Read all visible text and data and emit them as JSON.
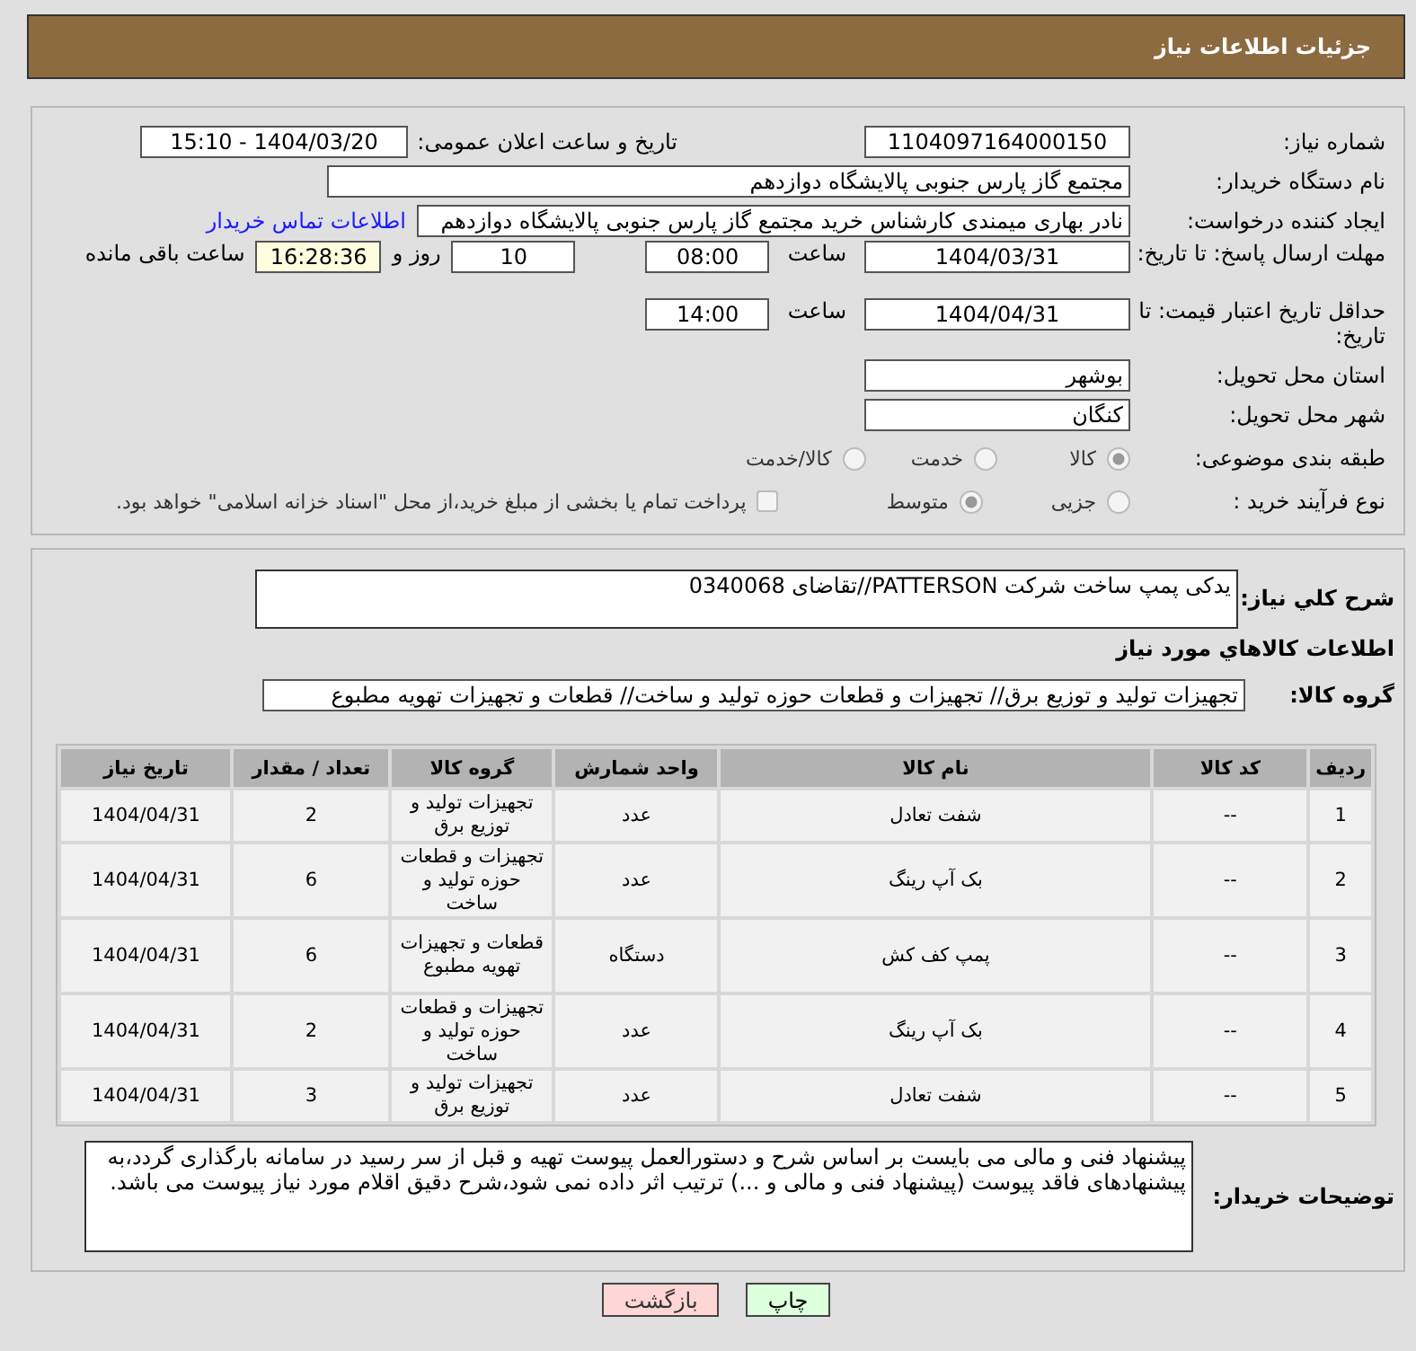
{
  "header": {
    "title": "جزئیات اطلاعات نیاز"
  },
  "details": {
    "need_number": {
      "label": "شماره نیاز:",
      "value": "1104097164000150"
    },
    "announce": {
      "label": "تاریخ و ساعت اعلان عمومی:",
      "value": "1404/03/20 - 15:10"
    },
    "buyer": {
      "label": "نام دستگاه خریدار:",
      "value": "مجتمع گاز پارس جنوبی  پالایشگاه دوازدهم"
    },
    "creator": {
      "label": "ایجاد کننده درخواست:",
      "value": "نادر بهاری میمندی کارشناس خرید مجتمع گاز پارس جنوبی  پالایشگاه دوازدهم",
      "link": "اطلاعات تماس خریدار"
    },
    "deadline": {
      "label": "مهلت ارسال پاسخ: تا تاریخ:",
      "date": "1404/03/31",
      "time_label": "ساعت",
      "time": "08:00",
      "days": "10",
      "days_label": "روز و",
      "remaining": "16:28:36",
      "remaining_label": "ساعت باقی مانده"
    },
    "validity": {
      "label": "حداقل تاریخ اعتبار قیمت: تا تاریخ:",
      "date": "1404/04/31",
      "time_label": "ساعت",
      "time": "14:00"
    },
    "province": {
      "label": "استان محل تحویل:",
      "value": "بوشهر"
    },
    "city": {
      "label": "شهر محل تحویل:",
      "value": "کنگان"
    },
    "category": {
      "label": "طبقه بندی موضوعی:",
      "options": [
        {
          "label": "کالا",
          "selected": true
        },
        {
          "label": "خدمت",
          "selected": false
        },
        {
          "label": "کالا/خدمت",
          "selected": false
        }
      ]
    },
    "process": {
      "label": "نوع فرآیند خرید :",
      "options": [
        {
          "label": "جزیی",
          "selected": false
        },
        {
          "label": "متوسط",
          "selected": true
        }
      ],
      "treasury": {
        "label": "پرداخت تمام یا بخشی از مبلغ خرید،از محل \"اسناد خزانه اسلامی\" خواهد بود.",
        "checked": false
      }
    }
  },
  "need": {
    "description_label": "شرح کلي نیاز:",
    "description": "یدکی پمپ ساخت شرکت PATTERSON//تقاضای 0340068",
    "goods_title": "اطلاعات کالاهاي مورد نیاز",
    "group_label": "گروه کالا:",
    "group": "تجهیزات تولید و توزیع برق// تجهیزات و قطعات حوزه تولید و ساخت//  قطعات و تجهیزات تهویه مطبوع"
  },
  "table": {
    "columns": [
      "ردیف",
      "کد کالا",
      "نام کالا",
      "واحد شمارش",
      "گروه کالا",
      "تعداد / مقدار",
      "تاریخ نیاز"
    ],
    "rows": [
      [
        "1",
        "--",
        "شفت تعادل",
        "عدد",
        "تجهیزات تولید و توزیع برق",
        "2",
        "1404/04/31"
      ],
      [
        "2",
        "--",
        "بک آپ رینگ",
        "عدد",
        "تجهیزات و قطعات حوزه تولید و ساخت",
        "6",
        "1404/04/31"
      ],
      [
        "3",
        "--",
        "پمپ کف کش",
        "دستگاه",
        "قطعات و تجهیزات تهویه مطبوع",
        "6",
        "1404/04/31"
      ],
      [
        "4",
        "--",
        "بک آپ رینگ",
        "عدد",
        "تجهیزات و قطعات حوزه تولید و ساخت",
        "2",
        "1404/04/31"
      ],
      [
        "5",
        "--",
        "شفت تعادل",
        "عدد",
        "تجهیزات تولید و توزیع برق",
        "3",
        "1404/04/31"
      ]
    ]
  },
  "notes": {
    "label": "توضیحات خریدار:",
    "value": "پیشنهاد فنی و مالی می بایست بر اساس شرح و دستورالعمل پیوست تهیه و قبل از سر رسید در سامانه بارگذاری گردد،به پیشنهادهای فاقد پیوست (پیشنهاد فنی و مالی و ...) ترتیب اثر داده نمی شود،شرح دقیق اقلام مورد نیاز پیوست می باشد."
  },
  "buttons": [
    {
      "label": "چاپ",
      "kind": "print"
    },
    {
      "label": "بازگشت",
      "kind": "back"
    }
  ]
}
